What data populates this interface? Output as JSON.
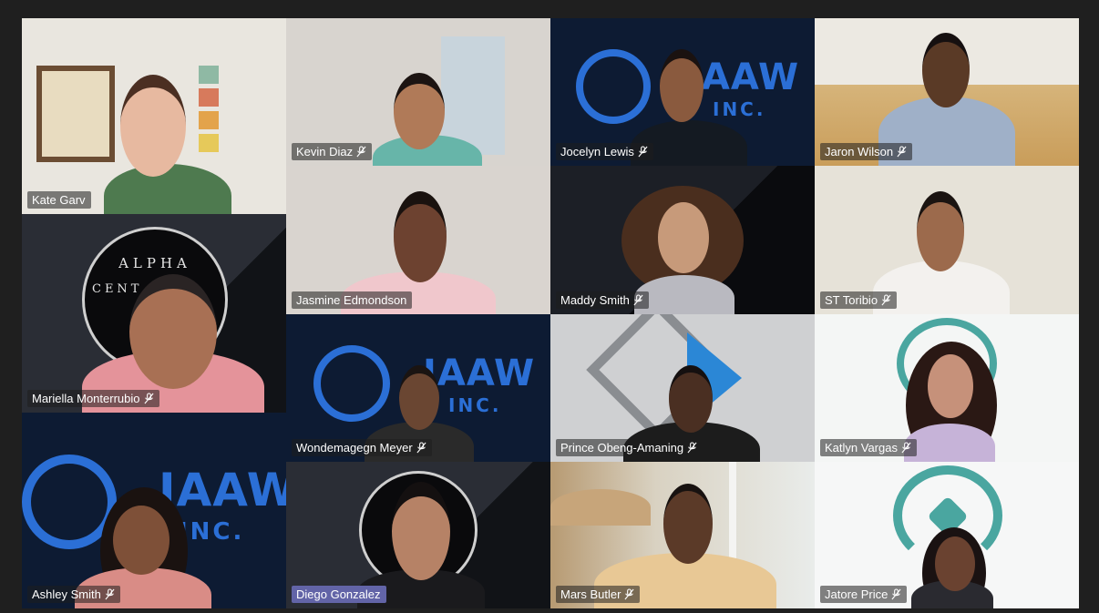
{
  "meeting": {
    "participants": [
      {
        "name": "Kate Garv",
        "muted": false,
        "highlight": false
      },
      {
        "name": "Kevin Diaz",
        "muted": true,
        "highlight": false
      },
      {
        "name": "Jocelyn Lewis",
        "muted": true,
        "highlight": false
      },
      {
        "name": "Jaron Wilson",
        "muted": true,
        "highlight": false
      },
      {
        "name": "Jasmine Edmondson",
        "muted": false,
        "highlight": false
      },
      {
        "name": "Maddy Smith",
        "muted": true,
        "highlight": false
      },
      {
        "name": "ST Toribio",
        "muted": true,
        "highlight": false
      },
      {
        "name": "Mariella Monterrubio",
        "muted": true,
        "highlight": false
      },
      {
        "name": "Wondemagegn Meyer",
        "muted": true,
        "highlight": false
      },
      {
        "name": "Prince Obeng-Amaning",
        "muted": true,
        "highlight": false
      },
      {
        "name": "Katlyn Vargas",
        "muted": true,
        "highlight": false
      },
      {
        "name": "Ashley Smith",
        "muted": true,
        "highlight": false
      },
      {
        "name": "Diego Gonzalez",
        "muted": false,
        "highlight": true
      },
      {
        "name": "Mars Butler",
        "muted": true,
        "highlight": false
      },
      {
        "name": "Jatore Price",
        "muted": true,
        "highlight": false
      }
    ],
    "backgrounds": {
      "jaaw_main": "JAAW",
      "jaaw_sub": "INC.",
      "alpha_top": "ALPHA",
      "alpha_bottom": "CENT"
    },
    "colors": {
      "accent": "#6264a7",
      "jaaw_blue": "#2b6fd6",
      "jaaw_bg": "#0d1b33",
      "teal": "#4aa6a0"
    }
  }
}
